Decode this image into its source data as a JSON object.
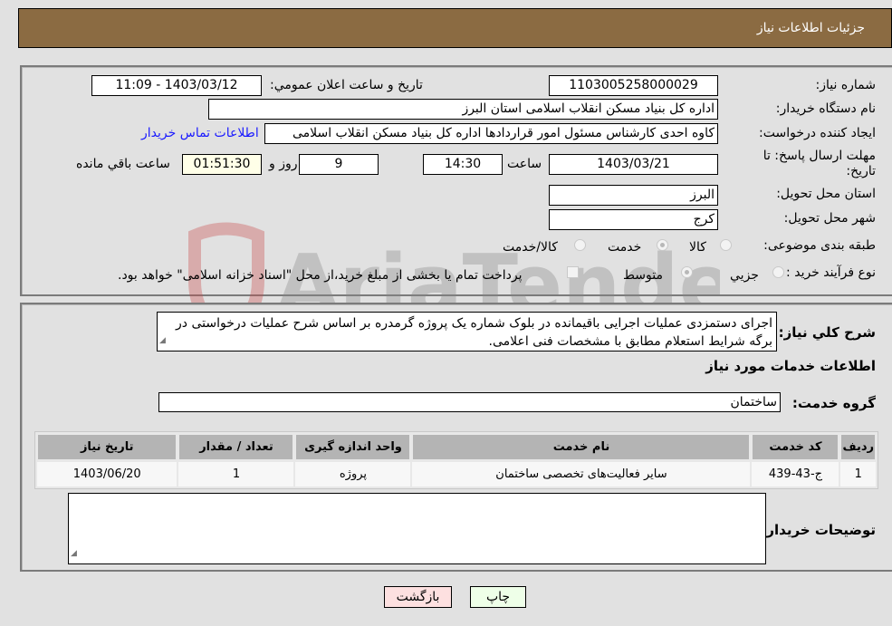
{
  "header": {
    "title": "جزئیات اطلاعات نیاز"
  },
  "details": {
    "need_number_label": "شماره نیاز:",
    "need_number": "1103005258000029",
    "announce_label": "تاريخ و ساعت اعلان عمومي:",
    "announce_value": "1403/03/12 - 11:09",
    "buyer_label": "نام دستگاه خريدار:",
    "buyer_value": "اداره کل بنیاد مسکن انقلاب اسلامی استان البرز",
    "requester_label": "ايجاد کننده درخواست:",
    "requester_value": "کاوه احدی کارشناس مسئول امور قراردادها اداره کل بنیاد مسکن انقلاب اسلامی",
    "contact_link": "اطلاعات تماس خریدار",
    "deadline_label": "مهلت ارسال پاسخ: تا تاریخ:",
    "deadline_date": "1403/03/21",
    "time_label": "ساعت",
    "deadline_time": "14:30",
    "days_value": "9",
    "days_label": "روز و",
    "remaining_value": "01:51:30",
    "remaining_label": "ساعت باقي مانده",
    "province_label": "استان محل تحويل:",
    "province_value": "البرز",
    "city_label": "شهر محل تحويل:",
    "city_value": "کرج",
    "category_label": "طبقه بندی موضوعی:",
    "category_options": [
      {
        "label": "کالا",
        "checked": false
      },
      {
        "label": "خدمت",
        "checked": true
      },
      {
        "label": "کالا/خدمت",
        "checked": false
      }
    ],
    "process_label": "نوع فرآيند خريد :",
    "process_options": [
      {
        "label": "جزيي",
        "checked": false
      },
      {
        "label": "متوسط",
        "checked": true
      }
    ],
    "treasury_text": "پرداخت تمام یا بخشی از مبلغ خرید،از محل \"اسناد خزانه اسلامی\" خواهد بود.",
    "treasury_checked": false
  },
  "description": {
    "label": "شرح کلي نياز:",
    "value": "اجرای دستمزدی عملیات اجرایی باقیمانده در بلوک شماره یک پروژه گرمدره بر اساس شرح عملیات درخواستی در برگه شرایط استعلام مطابق با مشخصات فنی اعلامی."
  },
  "services": {
    "section_title": "اطلاعات خدمات مورد نياز",
    "group_label": "گروه خدمت:",
    "group_value": "ساختمان",
    "columns": [
      "رديف",
      "کد خدمت",
      "نام خدمت",
      "واحد اندازه گيری",
      "تعداد / مقدار",
      "تاريخ نياز"
    ],
    "rows": [
      [
        "1",
        "ج-43-439",
        "سایر فعالیت‌های تخصصی ساختمان",
        "پروژه",
        "1",
        "1403/06/20"
      ]
    ]
  },
  "buyer_notes": {
    "label": "توضيحات خريدار:",
    "value": ""
  },
  "buttons": {
    "print": "چاپ",
    "back": "بازگشت"
  },
  "watermark": {
    "text": "AriaTender.neT"
  }
}
